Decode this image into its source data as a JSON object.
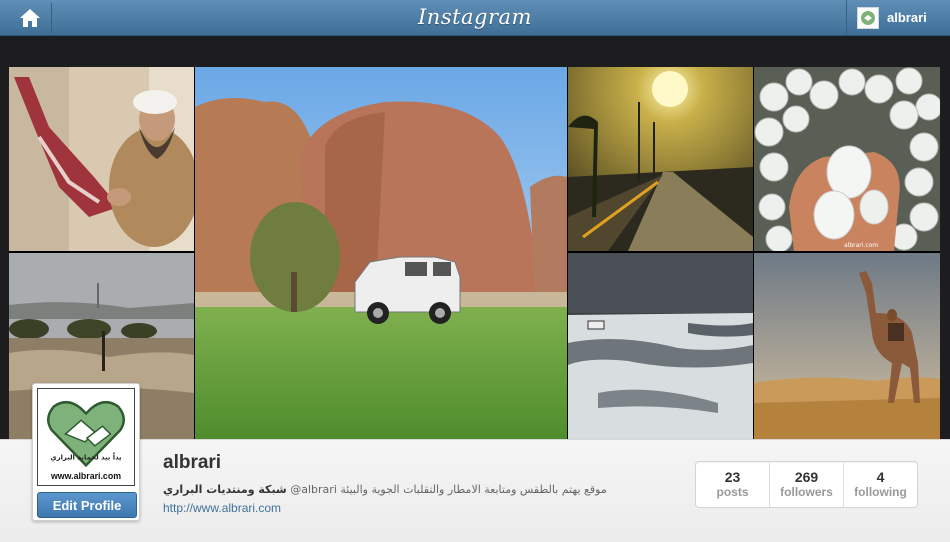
{
  "header": {
    "logo_text": "Instagram",
    "username": "albrari"
  },
  "profile": {
    "username": "albrari",
    "bio_bold": "شبكة ومنتديات البراري",
    "bio_text": "@albrari موقع يهتم بالطقس ومتابعة الامطار والتقلبات الجوية والبيئة",
    "website": "http://www.albrari.com",
    "edit_label": "Edit Profile",
    "avatar_caption": "www.albrari.com",
    "avatar_arabic": "يداً بيد لحماية البراري"
  },
  "stats": [
    {
      "count": "23",
      "label": "posts"
    },
    {
      "count": "269",
      "label": "followers"
    },
    {
      "count": "4",
      "label": "following"
    }
  ],
  "photos": [
    {
      "subject": "man-with-meat"
    },
    {
      "subject": "rock-formation-suv"
    },
    {
      "subject": "road-sunset"
    },
    {
      "subject": "hailstones-hand",
      "caption": "albrari.com"
    },
    {
      "subject": "flooded-desert"
    },
    {
      "subject": "hail-ground"
    },
    {
      "subject": "camel-rider"
    }
  ]
}
